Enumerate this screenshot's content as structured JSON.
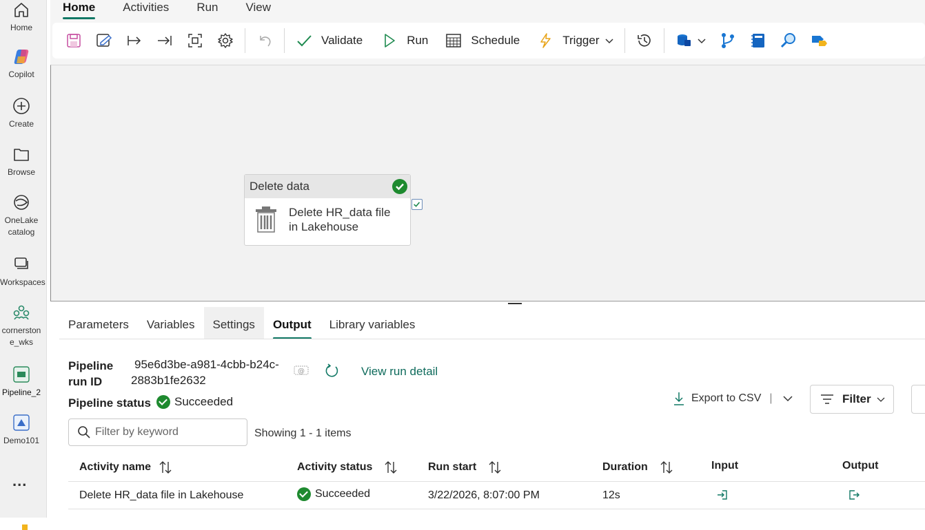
{
  "rail": {
    "items": [
      {
        "label": "Home",
        "icon": "home-icon"
      },
      {
        "label": "Copilot",
        "icon": "copilot-icon"
      },
      {
        "label": "Create",
        "icon": "create-icon"
      },
      {
        "label": "Browse",
        "icon": "folder-icon"
      },
      {
        "label": "OneLake catalog",
        "icon": "onelake-icon"
      },
      {
        "label": "Workspaces",
        "icon": "workspaces-icon"
      },
      {
        "label": "cornerstone_wks",
        "icon": "workspace-group-icon"
      },
      {
        "label": "Pipeline_2",
        "icon": "pipeline-icon"
      },
      {
        "label": "Demo101",
        "icon": "lakehouse-icon"
      }
    ],
    "more": "..."
  },
  "menu": {
    "tabs": [
      "Home",
      "Activities",
      "Run",
      "View"
    ],
    "active": "Home"
  },
  "toolbar": {
    "validate_label": "Validate",
    "run_label": "Run",
    "schedule_label": "Schedule",
    "trigger_label": "Trigger"
  },
  "canvas": {
    "activity": {
      "type": "Delete data",
      "name": "Delete HR_data file in Lakehouse",
      "name_line1": "Delete HR_data file",
      "name_line2": "in Lakehouse",
      "status_color": "#1e8a2f"
    }
  },
  "bottom": {
    "tabs": [
      "Parameters",
      "Variables",
      "Settings",
      "Output",
      "Library variables"
    ],
    "active_tab": "Output",
    "run_id_label_1": "Pipeline",
    "run_id_label_2": "run ID",
    "run_id_line1": "95e6d3be-a981-4cbb-b24c-",
    "run_id_line2": "2883b1fe2632",
    "view_run_detail": "View run detail",
    "status_label": "Pipeline status",
    "status_value": "Succeeded",
    "export_label": "Export to CSV",
    "filter_label": "Filter",
    "search_placeholder": "Filter by keyword",
    "showing": "Showing 1 - 1 items"
  },
  "table": {
    "columns": [
      "Activity name",
      "Activity status",
      "Run start",
      "Duration",
      "Input",
      "Output"
    ],
    "rows": [
      {
        "activity_name": "Delete HR_data file in Lakehouse",
        "status": "Succeeded",
        "run_start": "3/22/2026, 8:07:00 PM",
        "duration": "12s"
      }
    ]
  },
  "colors": {
    "accent": "#117865",
    "success": "#1e8a2f"
  }
}
